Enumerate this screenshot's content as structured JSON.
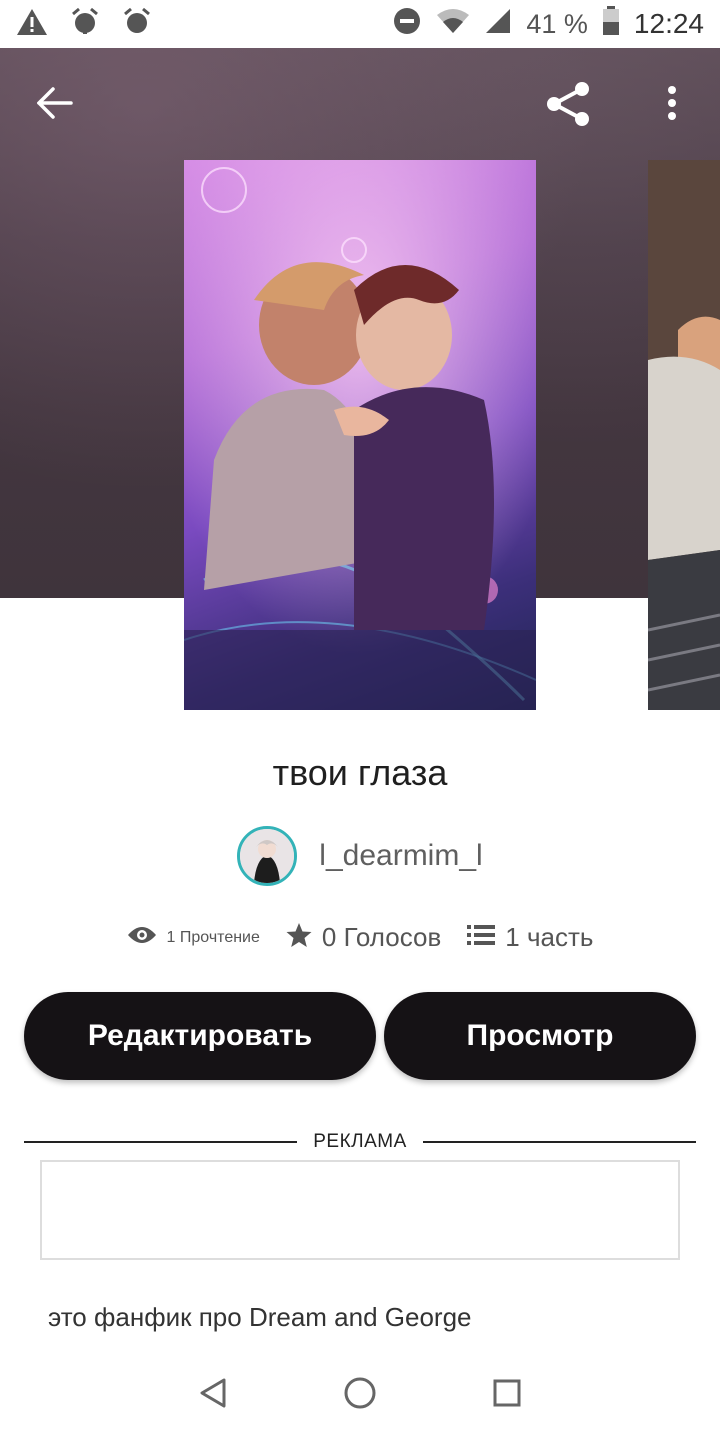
{
  "status_bar": {
    "battery_percent": "41 %",
    "time": "12:24",
    "left_icons": [
      "warning-icon",
      "alarm-icon",
      "alarm-icon"
    ],
    "right_icons": [
      "dnd-icon",
      "wifi-icon",
      "signal-icon",
      "battery-icon"
    ]
  },
  "header": {
    "back_icon": "back-arrow-icon",
    "share_icon": "share-icon",
    "menu_icon": "more-vert-icon"
  },
  "story": {
    "title": "твои глаза",
    "author": "l_dearmim_l",
    "reads": "1 Прочтение",
    "votes": "0 Голосов",
    "parts": "1 часть",
    "description": "это фанфик про Dream and George"
  },
  "actions": {
    "edit_label": "Редактировать",
    "view_label": "Просмотр"
  },
  "ad": {
    "label": "РЕКЛАМА"
  },
  "colors": {
    "button_bg": "#151215",
    "avatar_ring": "#33b3b8",
    "hero_bg": "#4a3c46"
  }
}
